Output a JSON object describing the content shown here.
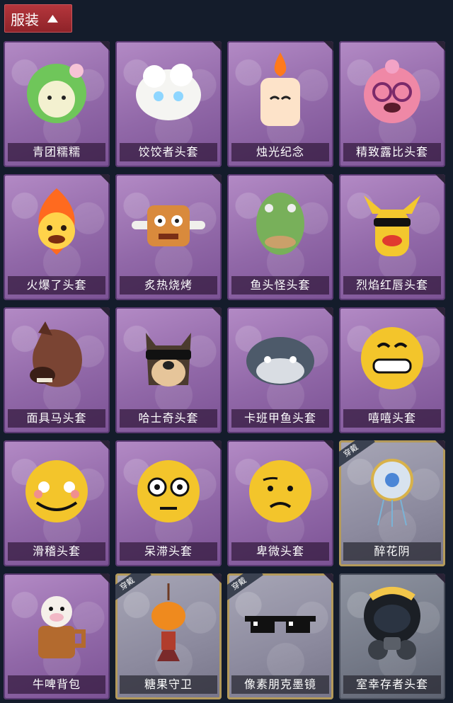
{
  "header": {
    "label": "服装",
    "chevron_icon": "chevron-up-icon"
  },
  "items": [
    {
      "name": "青团糯糯",
      "icon": "green-ball-mask-icon",
      "worn": false,
      "style": "purple"
    },
    {
      "name": "饺饺者头套",
      "icon": "dumpling-mask-icon",
      "worn": false,
      "style": "purple"
    },
    {
      "name": "烛光纪念",
      "icon": "candle-mask-icon",
      "worn": false,
      "style": "purple"
    },
    {
      "name": "精致露比头套",
      "icon": "pink-pig-mask-icon",
      "worn": false,
      "style": "purple"
    },
    {
      "name": "火爆了头套",
      "icon": "fire-mask-icon",
      "worn": false,
      "style": "purple"
    },
    {
      "name": "炙热烧烤",
      "icon": "bbq-mask-icon",
      "worn": false,
      "style": "purple"
    },
    {
      "name": "鱼头怪头套",
      "icon": "fish-head-mask-icon",
      "worn": false,
      "style": "purple"
    },
    {
      "name": "烈焰红唇头套",
      "icon": "yellow-lips-mask-icon",
      "worn": false,
      "style": "purple"
    },
    {
      "name": "面具马头套",
      "icon": "horse-mask-icon",
      "worn": false,
      "style": "purple"
    },
    {
      "name": "哈士奇头套",
      "icon": "husky-mask-icon",
      "worn": false,
      "style": "purple"
    },
    {
      "name": "卡班甲鱼头套",
      "icon": "turtle-mask-icon",
      "worn": false,
      "style": "purple"
    },
    {
      "name": "嘻嘻头套",
      "icon": "grin-emoji-mask-icon",
      "worn": false,
      "style": "purple"
    },
    {
      "name": "滑稽头套",
      "icon": "smirk-emoji-mask-icon",
      "worn": false,
      "style": "purple"
    },
    {
      "name": "呆滞头套",
      "icon": "stunned-emoji-mask-icon",
      "worn": false,
      "style": "purple"
    },
    {
      "name": "卑微头套",
      "icon": "humble-emoji-mask-icon",
      "worn": false,
      "style": "purple"
    },
    {
      "name": "醉花阴",
      "icon": "floral-pendant-icon",
      "worn": true,
      "style": "special"
    },
    {
      "name": "牛啤背包",
      "icon": "cow-beer-backpack-icon",
      "worn": false,
      "style": "purple"
    },
    {
      "name": "糖果守卫",
      "icon": "pumpkin-pendant-icon",
      "worn": true,
      "style": "special"
    },
    {
      "name": "像素朋克墨镜",
      "icon": "pixel-sunglasses-icon",
      "worn": true,
      "style": "special"
    },
    {
      "name": "室幸存者头套",
      "icon": "gas-mask-icon",
      "worn": false,
      "style": "dark"
    }
  ],
  "worn_label": "穿戴"
}
